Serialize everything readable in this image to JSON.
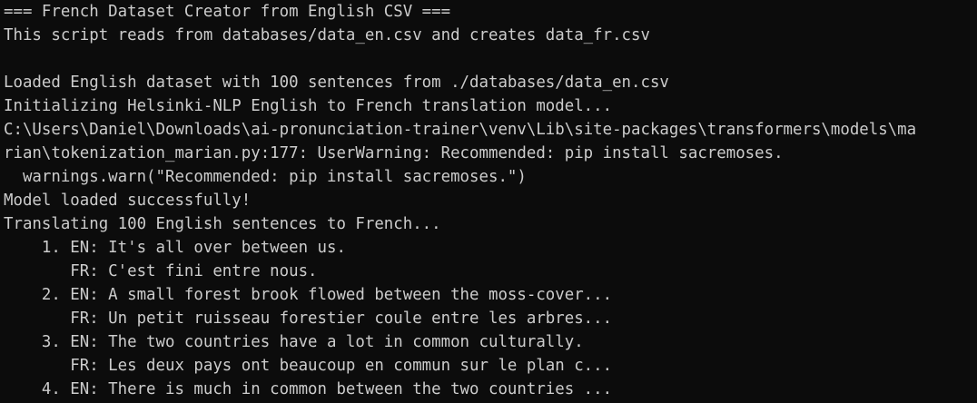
{
  "terminal": {
    "lines": [
      "=== French Dataset Creator from English CSV ===",
      "This script reads from databases/data_en.csv and creates data_fr.csv",
      "",
      "Loaded English dataset with 100 sentences from ./databases/data_en.csv",
      "Initializing Helsinki-NLP English to French translation model...",
      "C:\\Users\\Daniel\\Downloads\\ai-pronunciation-trainer\\venv\\Lib\\site-packages\\transformers\\models\\ma",
      "rian\\tokenization_marian.py:177: UserWarning: Recommended: pip install sacremoses.",
      "  warnings.warn(\"Recommended: pip install sacremoses.\")",
      "Model loaded successfully!",
      "Translating 100 English sentences to French...",
      "    1. EN: It's all over between us.",
      "       FR: C'est fini entre nous.",
      "    2. EN: A small forest brook flowed between the moss-cover...",
      "       FR: Un petit ruisseau forestier coule entre les arbres...",
      "    3. EN: The two countries have a lot in common culturally.",
      "       FR: Les deux pays ont beaucoup en commun sur le plan c...",
      "    4. EN: There is much in common between the two countries ..."
    ]
  },
  "colors": {
    "background": "#0c0c0c",
    "foreground": "#cccccc"
  }
}
